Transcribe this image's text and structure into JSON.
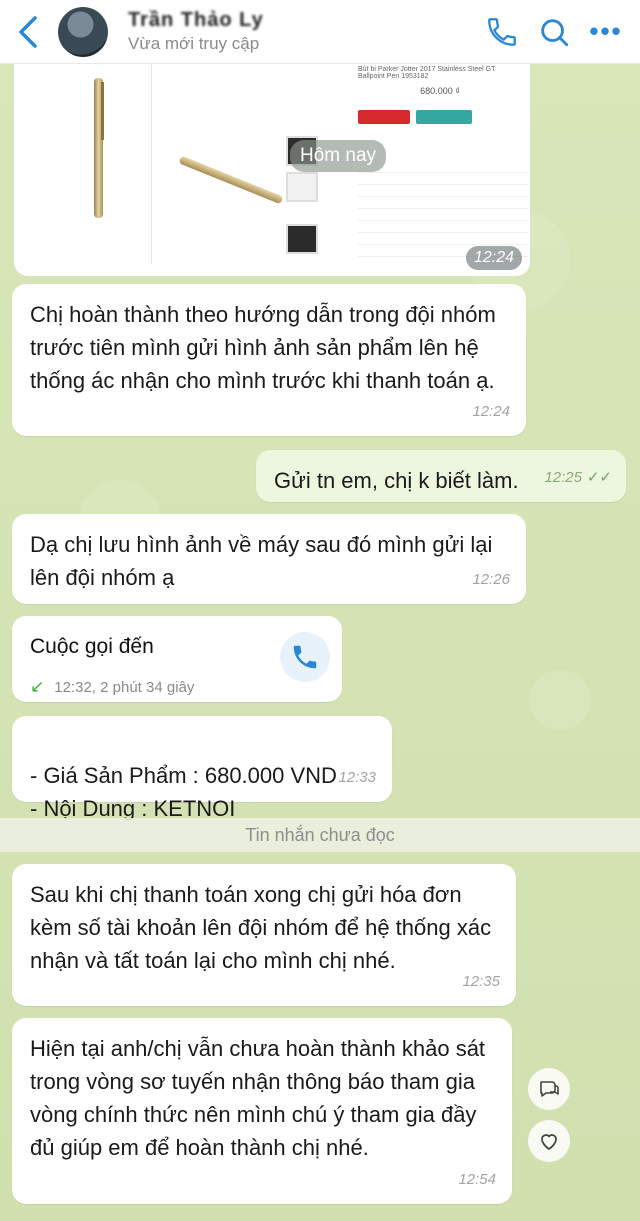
{
  "header": {
    "contact_name": "Trần Thảo Ly",
    "status": "Vừa mới truy cập",
    "back_icon": "chevron-left-icon",
    "call_icon": "phone-icon",
    "search_icon": "search-icon",
    "more_icon": "more-dots-icon",
    "more_glyph": "•••"
  },
  "shared_image": {
    "day_label": "Hôm nay",
    "time": "12:24",
    "product_title": "Bút bi Parker Jotter 2017 Stainless Steel GT Ballpoint Pen 1953182",
    "price": "680.000 ₫"
  },
  "messages": [
    {
      "id": "m1",
      "direction": "in",
      "text": "Chị hoàn thành theo hướng dẫn trong đội nhóm trước tiên mình gửi hình ảnh sản phẩm lên hệ thống ác nhận cho mình trước khi thanh toán ạ.",
      "time": "12:24"
    },
    {
      "id": "m2",
      "direction": "out",
      "text": "Gửi tn em, chị k biết làm.",
      "time": "12:25",
      "read_mark": "✓✓"
    },
    {
      "id": "m3",
      "direction": "in",
      "text": "Dạ chị lưu hình ảnh về máy sau đó mình gửi lại lên đội nhóm ạ",
      "time": "12:26"
    },
    {
      "id": "m5",
      "direction": "in",
      "text": "- Giá Sản Phẩm : 680.000 VND\n- Nội Dung : KETNOI",
      "time": "12:33"
    },
    {
      "id": "m6",
      "direction": "in",
      "text": "Sau khi chị thanh toán xong chị gửi hóa đơn kèm số tài khoản lên đội nhóm để hệ thống xác nhận và tất toán lại cho mình chị nhé.",
      "time": "12:35"
    },
    {
      "id": "m7",
      "direction": "in",
      "text": "Hiện tại anh/chị vẫn chưa hoàn thành khảo sát trong vòng sơ tuyến nhận thông báo tham gia vòng chính thức nên mình chú ý tham gia đầy đủ giúp em để hoàn thành chị nhé.",
      "time": "12:54"
    }
  ],
  "call": {
    "title": "Cuộc gọi đến",
    "arrow": "↙",
    "meta": "12:32, 2 phút 34 giây",
    "icon": "phone-icon"
  },
  "unread_divider": "Tin nhắn chưa đọc",
  "side_actions": {
    "reply_icon": "quick-reply-icon",
    "like_icon": "heart-icon"
  },
  "colors": {
    "accent": "#2a86d6",
    "chat_bg": "#d6e3b6",
    "incoming_bubble": "#ffffff",
    "outgoing_bubble": "#edf7df"
  }
}
